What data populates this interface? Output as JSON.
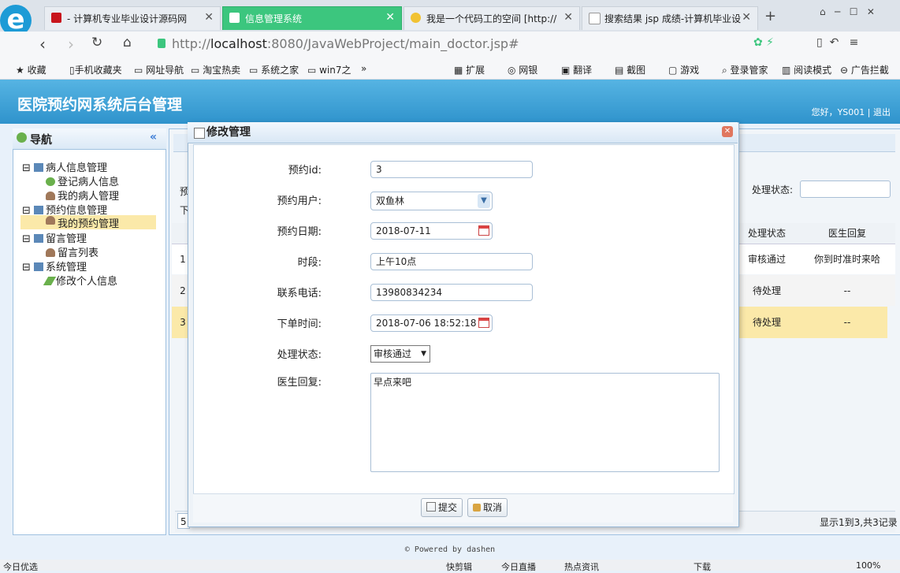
{
  "browser": {
    "tabs": [
      {
        "label": "- 计算机专业毕业设计源码网",
        "active": false
      },
      {
        "label": "信息管理系统",
        "active": true
      },
      {
        "label": "我是一个代码工的空间 [http://",
        "active": false
      },
      {
        "label": "搜索结果 jsp 成绩-计算机毕业设",
        "active": false
      }
    ],
    "new_tab": "+",
    "url_prefix": "http://",
    "url_host": "localhost",
    "url_rest": ":8080/JavaWebProject/main_doctor.jsp#",
    "bookmarks": [
      "收藏",
      "手机收藏夹",
      "网址导航",
      "淘宝热卖",
      "系统之家",
      "win7之",
      "»"
    ],
    "toolbar_right": [
      "扩展",
      "网银",
      "翻译",
      "截图",
      "游戏",
      "登录管家",
      "阅读模式",
      "广告拦截"
    ]
  },
  "app": {
    "title": "医院预约网系统后台管理",
    "greeting": "您好，YS001",
    "separator": "|",
    "logout": "退出",
    "footer": "© Powered by dashen"
  },
  "sidebar": {
    "title": "导航",
    "collapse_glyph": "«",
    "groups": [
      {
        "label": "病人信息管理",
        "items": [
          "登记病人信息",
          "我的病人管理"
        ]
      },
      {
        "label": "预约信息管理",
        "items": [
          "我的预约管理"
        ]
      },
      {
        "label": "留言管理",
        "items": [
          "留言列表"
        ]
      },
      {
        "label": "系统管理",
        "items": [
          "修改个人信息"
        ]
      }
    ],
    "selected": "我的预约管理"
  },
  "background_grid": {
    "filter_label": "处理状态:",
    "columns": [
      "处理状态",
      "医生回复"
    ],
    "rows": [
      {
        "num": "1",
        "status": "审核通过",
        "reply": "你到时准时来哈"
      },
      {
        "num": "2",
        "status": "待处理",
        "reply": "--"
      },
      {
        "num": "3",
        "status": "待处理",
        "reply": "--"
      }
    ],
    "pager_size": "5",
    "pager_info": "显示1到3,共3记录",
    "left_fragments": [
      "预",
      "下"
    ]
  },
  "dialog": {
    "title": "修改管理",
    "close_glyph": "✕",
    "fields": [
      {
        "label": "预约id:",
        "value": "3"
      },
      {
        "label": "预约用户:",
        "value": "双鱼林"
      },
      {
        "label": "预约日期:",
        "value": "2018-07-11"
      },
      {
        "label": "时段:",
        "value": "上午10点"
      },
      {
        "label": "联系电话:",
        "value": "13980834234"
      },
      {
        "label": "下单时间:",
        "value": "2018-07-06 18:52:18"
      },
      {
        "label": "处理状态:",
        "value": "审核通过"
      },
      {
        "label": "医生回复:",
        "value": "早点来吧"
      }
    ],
    "submit": "提交",
    "cancel": "取消"
  },
  "statusbar": {
    "left": "今日优选",
    "items": [
      "快剪辑",
      "今日直播",
      "热点资讯",
      "下载",
      "100%"
    ]
  },
  "colors": {
    "header": "#2f93cc",
    "active_tab": "#3cc67e",
    "selected_row": "#fbe9a9"
  }
}
